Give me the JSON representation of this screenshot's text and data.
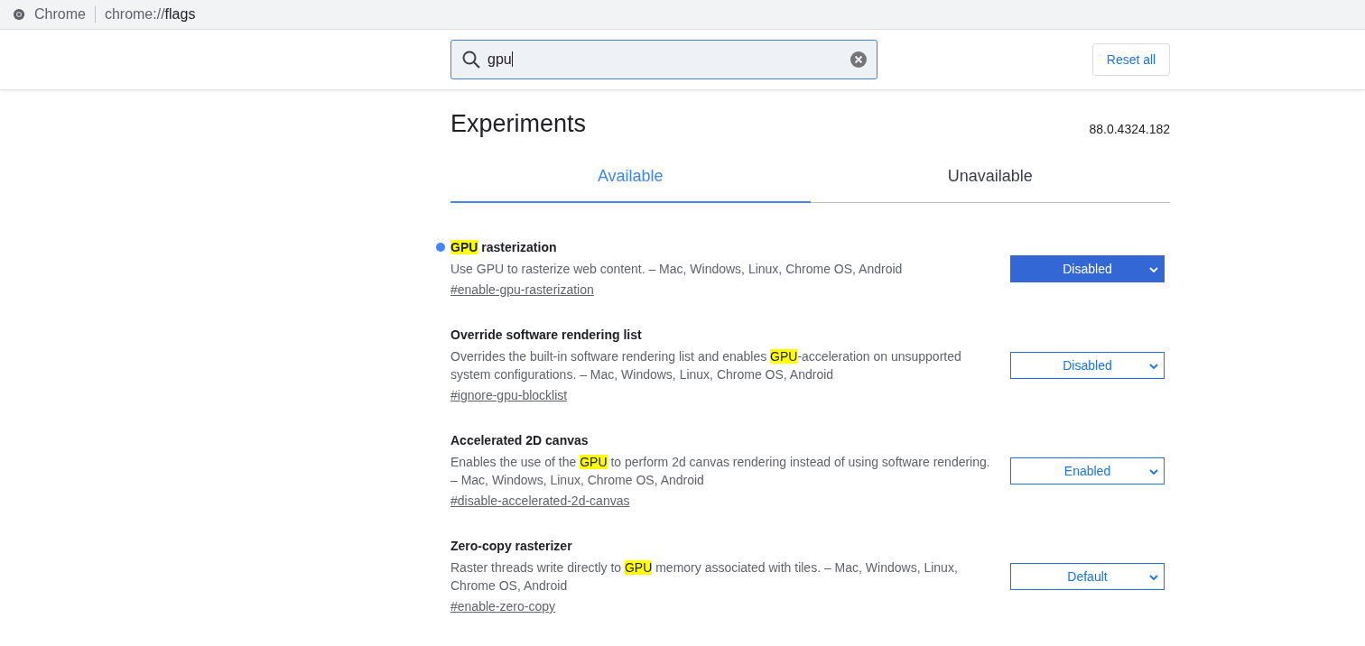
{
  "address_bar": {
    "site_label": "Chrome",
    "url_scheme": "chrome://",
    "url_path": "flags"
  },
  "search": {
    "value": "gpu"
  },
  "reset_button": "Reset all",
  "title": "Experiments",
  "version": "88.0.4324.182",
  "tabs": [
    {
      "label": "Available",
      "selected": true
    },
    {
      "label": "Unavailable",
      "selected": false
    }
  ],
  "flags": [
    {
      "title": [
        {
          "text": "GPU",
          "highlight": true
        },
        {
          "text": " rasterization",
          "highlight": false
        }
      ],
      "modified": true,
      "description": [
        {
          "text": "Use GPU to rasterize web content. – Mac, Windows, Linux, Chrome OS, Android",
          "highlight": false
        }
      ],
      "link": "#enable-gpu-rasterization",
      "value": "Disabled"
    },
    {
      "title": [
        {
          "text": "Override software rendering list",
          "highlight": false
        }
      ],
      "modified": false,
      "description": [
        {
          "text": "Overrides the built-in software rendering list and enables ",
          "highlight": false
        },
        {
          "text": "GPU",
          "highlight": true
        },
        {
          "text": "-acceleration on unsupported system configurations. – Mac, Windows, Linux, Chrome OS, Android",
          "highlight": false
        }
      ],
      "link": "#ignore-gpu-blocklist",
      "value": "Disabled"
    },
    {
      "title": [
        {
          "text": "Accelerated 2D canvas",
          "highlight": false
        }
      ],
      "modified": false,
      "description": [
        {
          "text": "Enables the use of the ",
          "highlight": false
        },
        {
          "text": "GPU",
          "highlight": true
        },
        {
          "text": " to perform 2d canvas rendering instead of using software rendering. – Mac, Windows, Linux, Chrome OS, Android",
          "highlight": false
        }
      ],
      "link": "#disable-accelerated-2d-canvas",
      "value": "Enabled"
    },
    {
      "title": [
        {
          "text": "Zero-copy rasterizer",
          "highlight": false
        }
      ],
      "modified": false,
      "description": [
        {
          "text": "Raster threads write directly to ",
          "highlight": false
        },
        {
          "text": "GPU",
          "highlight": true
        },
        {
          "text": " memory associated with tiles. – Mac, Windows, Linux, Chrome OS, Android",
          "highlight": false
        }
      ],
      "link": "#enable-zero-copy",
      "value": "Default"
    }
  ]
}
